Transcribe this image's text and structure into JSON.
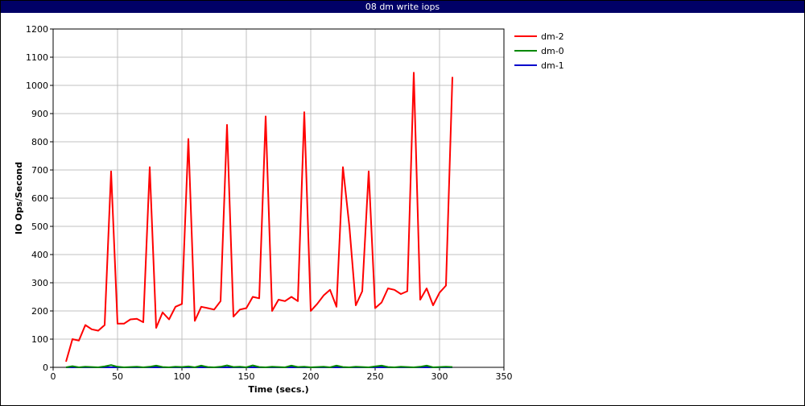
{
  "window": {
    "title": "08 dm write iops"
  },
  "chart_data": {
    "type": "line",
    "title": "08 dm write iops",
    "xlabel": "Time (secs.)",
    "ylabel": "IO Ops/Second",
    "xlim": [
      0,
      350
    ],
    "ylim": [
      0,
      1200
    ],
    "xticks": [
      0,
      50,
      100,
      150,
      200,
      250,
      300,
      350
    ],
    "yticks": [
      0,
      100,
      200,
      300,
      400,
      500,
      600,
      700,
      800,
      900,
      1000,
      1100,
      1200
    ],
    "grid": true,
    "legend_position": "top-right outside",
    "series": [
      {
        "name": "dm-2",
        "color": "#ff0000",
        "x": [
          10,
          15,
          20,
          25,
          30,
          35,
          40,
          45,
          50,
          55,
          60,
          65,
          70,
          75,
          80,
          85,
          90,
          95,
          100,
          105,
          110,
          115,
          120,
          125,
          130,
          135,
          140,
          145,
          150,
          155,
          160,
          165,
          170,
          175,
          180,
          185,
          190,
          195,
          200,
          205,
          210,
          215,
          220,
          225,
          230,
          235,
          240,
          245,
          250,
          255,
          260,
          265,
          270,
          275,
          280,
          285,
          290,
          295,
          300,
          305,
          310
        ],
        "values": [
          20,
          100,
          95,
          150,
          135,
          130,
          150,
          695,
          155,
          155,
          170,
          172,
          160,
          710,
          140,
          195,
          170,
          215,
          225,
          810,
          165,
          215,
          210,
          205,
          235,
          860,
          180,
          205,
          210,
          250,
          245,
          890,
          200,
          240,
          235,
          250,
          235,
          905,
          200,
          225,
          255,
          275,
          215,
          710,
          500,
          220,
          270,
          695,
          210,
          230,
          280,
          275,
          260,
          270,
          1045,
          240,
          280,
          220,
          265,
          290,
          1030
        ]
      },
      {
        "name": "dm-0",
        "color": "#008800",
        "x": [
          10,
          15,
          20,
          25,
          30,
          35,
          40,
          45,
          50,
          55,
          60,
          65,
          70,
          75,
          80,
          85,
          90,
          95,
          100,
          105,
          110,
          115,
          120,
          125,
          130,
          135,
          140,
          145,
          150,
          155,
          160,
          165,
          170,
          175,
          180,
          185,
          190,
          195,
          200,
          205,
          210,
          215,
          220,
          225,
          230,
          235,
          240,
          245,
          250,
          255,
          260,
          265,
          270,
          275,
          280,
          285,
          290,
          295,
          300,
          305,
          310
        ],
        "values": [
          0,
          4,
          0,
          2,
          1,
          0,
          3,
          8,
          2,
          0,
          1,
          2,
          0,
          2,
          6,
          1,
          0,
          2,
          1,
          3,
          0,
          6,
          1,
          0,
          2,
          7,
          1,
          2,
          0,
          7,
          1,
          0,
          2,
          1,
          0,
          6,
          1,
          2,
          0,
          1,
          2,
          0,
          6,
          1,
          0,
          2,
          1,
          0,
          3,
          6,
          1,
          0,
          2,
          1,
          0,
          2,
          6,
          0,
          1,
          2,
          1
        ]
      },
      {
        "name": "dm-1",
        "color": "#0000cc",
        "x": [
          10,
          50,
          100,
          150,
          200,
          250,
          300,
          310
        ],
        "values": [
          0,
          0,
          0,
          0,
          0,
          0,
          0,
          0
        ]
      }
    ]
  }
}
